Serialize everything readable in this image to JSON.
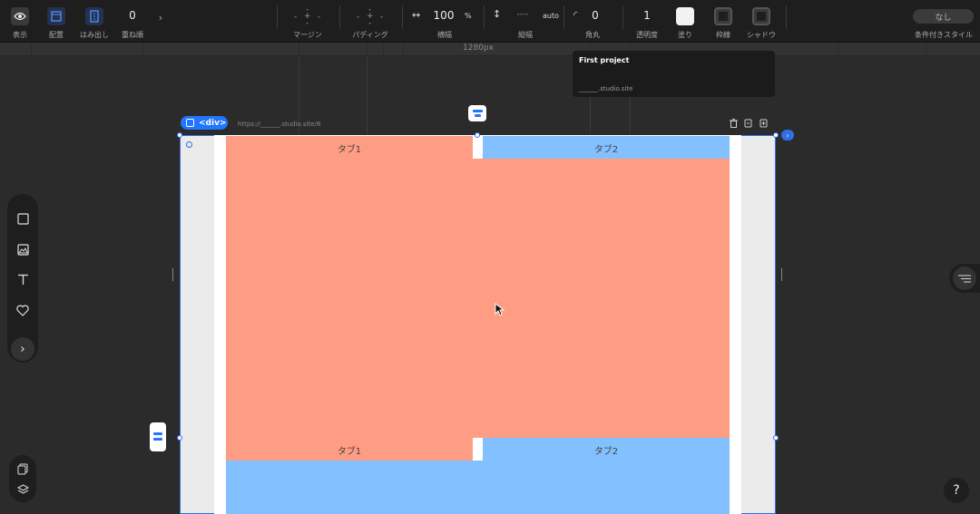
{
  "toolbar": {
    "display": "表示",
    "arrange": "配置",
    "overflow": "はみ出し",
    "stack_order_value": "0",
    "stack_order": "重ね順",
    "margin": "マージン",
    "padding": "パディング",
    "width_value": "100",
    "width_unit": "%",
    "width": "横幅",
    "height_value": "----",
    "height_unit": "auto",
    "height": "縦幅",
    "radius_value": "0",
    "radius": "角丸",
    "opacity_value": "1",
    "opacity": "透明度",
    "fill": "塗り",
    "border": "枠線",
    "shadow": "シャドウ",
    "conditional_value": "なし",
    "conditional": "条件付きスタイル"
  },
  "ruler": {
    "label": "1280px"
  },
  "tooltip": {
    "title": "First project",
    "url": "______.studio.site"
  },
  "frame": {
    "badge": "<div>",
    "url": "https://______.studio.site/8"
  },
  "tabs_top": [
    "タブ1",
    "タブ2"
  ],
  "tabs_bottom": [
    "タブ1",
    "タブ2"
  ],
  "side": {
    "help": "?"
  },
  "colors": {
    "salmon": "#ff9d84",
    "blue": "#83c0ff",
    "selection": "#2f6fe8",
    "badge": "#2176ff"
  },
  "icons": {
    "display": "eye-icon",
    "arrange": "layout-icon",
    "overflow": "overflow-icon",
    "width": "horizontal-arrows-icon",
    "height": "vertical-arrows-icon",
    "radius": "corner-radius-icon"
  }
}
